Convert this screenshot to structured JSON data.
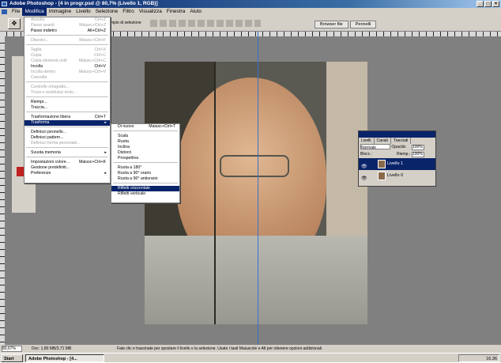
{
  "window": {
    "title": "Adobe Photoshop - [4 in progr.psd @ 80,7% (Livello 1, RGB)]"
  },
  "menubar": [
    "File",
    "Modifica",
    "Immagine",
    "Livello",
    "Selezione",
    "Filtro",
    "Visualizza",
    "Finestra",
    "Aiuto"
  ],
  "options": {
    "partial_label": "mpio di selezione"
  },
  "palette_tabs": [
    "Browser file",
    "Pennelli"
  ],
  "edit_menu": {
    "items": [
      {
        "label": "Annulla",
        "sc": "Ctrl+Z",
        "dis": true
      },
      {
        "label": "Passo avanti",
        "sc": "Maiusc+Ctrl+Z",
        "dis": true
      },
      {
        "label": "Passo indietro",
        "sc": "Alt+Ctrl+Z"
      },
      {
        "sep": true
      },
      {
        "label": "Dissolvi...",
        "sc": "Maiusc+Ctrl+F",
        "dis": true
      },
      {
        "sep": true
      },
      {
        "label": "Taglia",
        "sc": "Ctrl+X",
        "dis": true
      },
      {
        "label": "Copia",
        "sc": "Ctrl+C",
        "dis": true
      },
      {
        "label": "Copia elementi uniti",
        "sc": "Maiusc+Ctrl+C",
        "dis": true
      },
      {
        "label": "Incolla",
        "sc": "Ctrl+V"
      },
      {
        "label": "Incolla dentro",
        "sc": "Maiusc+Ctrl+V",
        "dis": true
      },
      {
        "label": "Cancella",
        "dis": true
      },
      {
        "sep": true
      },
      {
        "label": "Controllo ortografia...",
        "dis": true
      },
      {
        "label": "Trova e sostituisci testo...",
        "dis": true
      },
      {
        "sep": true
      },
      {
        "label": "Riempi..."
      },
      {
        "label": "Traccia..."
      },
      {
        "sep": true
      },
      {
        "label": "Trasformazione libera",
        "sc": "Ctrl+T"
      },
      {
        "label": "Trasforma",
        "arrow": true,
        "hi": true
      },
      {
        "sep": true
      },
      {
        "label": "Definisci pennello..."
      },
      {
        "label": "Definisci pattern..."
      },
      {
        "label": "Definisci forma personale...",
        "dis": true
      },
      {
        "sep": true
      },
      {
        "label": "Svuota memoria",
        "arrow": true
      },
      {
        "sep": true
      },
      {
        "label": "Impostazioni colore...",
        "sc": "Maiusc+Ctrl+K"
      },
      {
        "label": "Gestione predefiniti..."
      },
      {
        "label": "Preferenze",
        "arrow": true
      }
    ]
  },
  "transform_menu": {
    "items": [
      {
        "label": "Di nuovo",
        "sc": "Maiusc+Ctrl+T"
      },
      {
        "sep": true
      },
      {
        "label": "Scala"
      },
      {
        "label": "Ruota"
      },
      {
        "label": "Inclina"
      },
      {
        "label": "Distorci"
      },
      {
        "label": "Prospettiva"
      },
      {
        "sep": true
      },
      {
        "label": "Ruota a 180°"
      },
      {
        "label": "Ruota a 90° orario"
      },
      {
        "label": "Ruota a 90° antiorario"
      },
      {
        "sep": true
      },
      {
        "label": "Rifletti orizzontale",
        "hi": true
      },
      {
        "label": "Rifletti verticale"
      }
    ]
  },
  "layers": {
    "tabs": [
      "Livelli",
      "Canali",
      "Tracciati"
    ],
    "blend": "Normale",
    "opacity_label": "Opacità:",
    "opacity": "100%",
    "lock_label": "Blocc.:",
    "fill_label": "Riemp.:",
    "fill": "100%",
    "rows": [
      "Livello 1",
      "Livello 0"
    ]
  },
  "status": {
    "zoom": "80,67%",
    "doc": "Doc: 1,80 MB/3,71 MB",
    "hint": "Fate clic e trascinate per spostare il livello o la selezione. Usate i tasti Maiuscole e Alt per ottenere opzioni addizionali."
  },
  "taskbar": {
    "start": "Start",
    "task": "Adobe Photoshop - [4...",
    "clock": "16.36"
  }
}
